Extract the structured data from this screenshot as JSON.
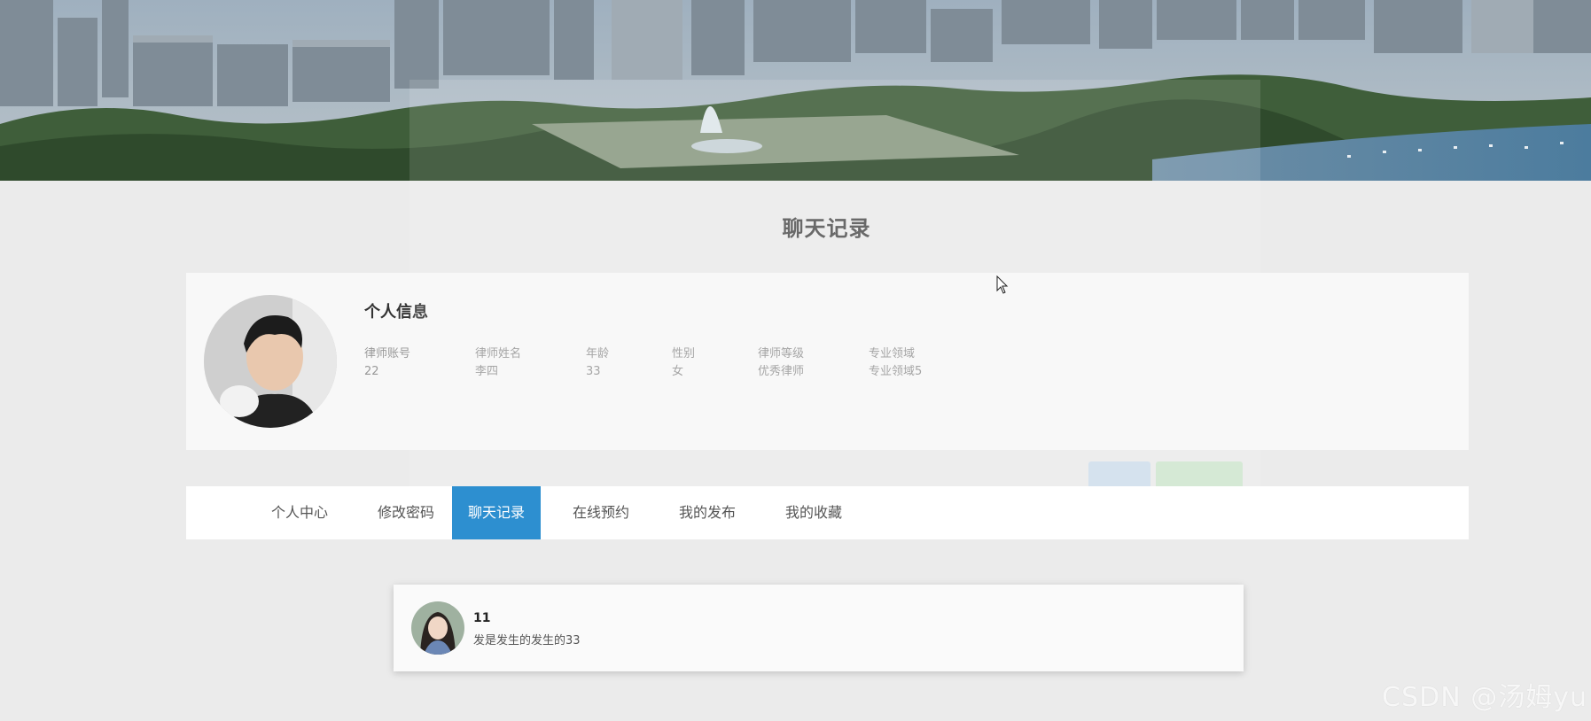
{
  "page": {
    "title": "聊天记录"
  },
  "profile": {
    "heading": "个人信息",
    "fields": [
      {
        "label": "律师账号",
        "value": "22"
      },
      {
        "label": "律师姓名",
        "value": "李四"
      },
      {
        "label": "年龄",
        "value": "33"
      },
      {
        "label": "性别",
        "value": "女"
      },
      {
        "label": "律师等级",
        "value": "优秀律师"
      },
      {
        "label": "专业领域",
        "value": "专业领域5"
      }
    ]
  },
  "tabs": [
    {
      "label": "个人中心",
      "active": false
    },
    {
      "label": "修改密码",
      "active": false
    },
    {
      "label": "聊天记录",
      "active": true
    },
    {
      "label": "在线预约",
      "active": false
    },
    {
      "label": "我的发布",
      "active": false
    },
    {
      "label": "我的收藏",
      "active": false
    }
  ],
  "chats": [
    {
      "name": "11",
      "message": "发是发生的发生的33"
    }
  ],
  "watermark": "CSDN @汤姆yu",
  "colors": {
    "accent": "#2d8fd0",
    "background": "#ebebeb"
  }
}
